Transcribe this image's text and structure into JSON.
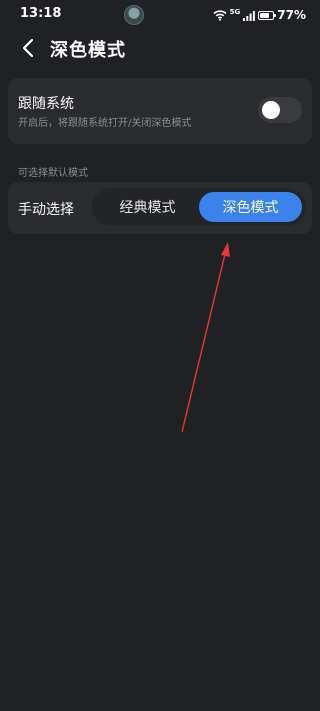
{
  "status_bar": {
    "time": "13:18",
    "network": "5G",
    "battery_percent": "77%",
    "battery_level": 0.77,
    "icons": [
      "wifi-icon",
      "signal-icon",
      "battery-icon"
    ]
  },
  "header": {
    "title": "深色模式",
    "back_icon": "chevron-left-icon"
  },
  "follow_system": {
    "title": "跟随系统",
    "subtitle": "开启后，将跟随系统打开/关闭深色模式",
    "enabled": false
  },
  "section_label": "可选择默认模式",
  "manual": {
    "label": "手动选择",
    "options": [
      "经典模式",
      "深色模式"
    ],
    "selected": "深色模式"
  },
  "colors": {
    "background": "#202124",
    "card": "#2a2b2f",
    "accent": "#3b82ea",
    "annotation_arrow": "#e53935"
  }
}
